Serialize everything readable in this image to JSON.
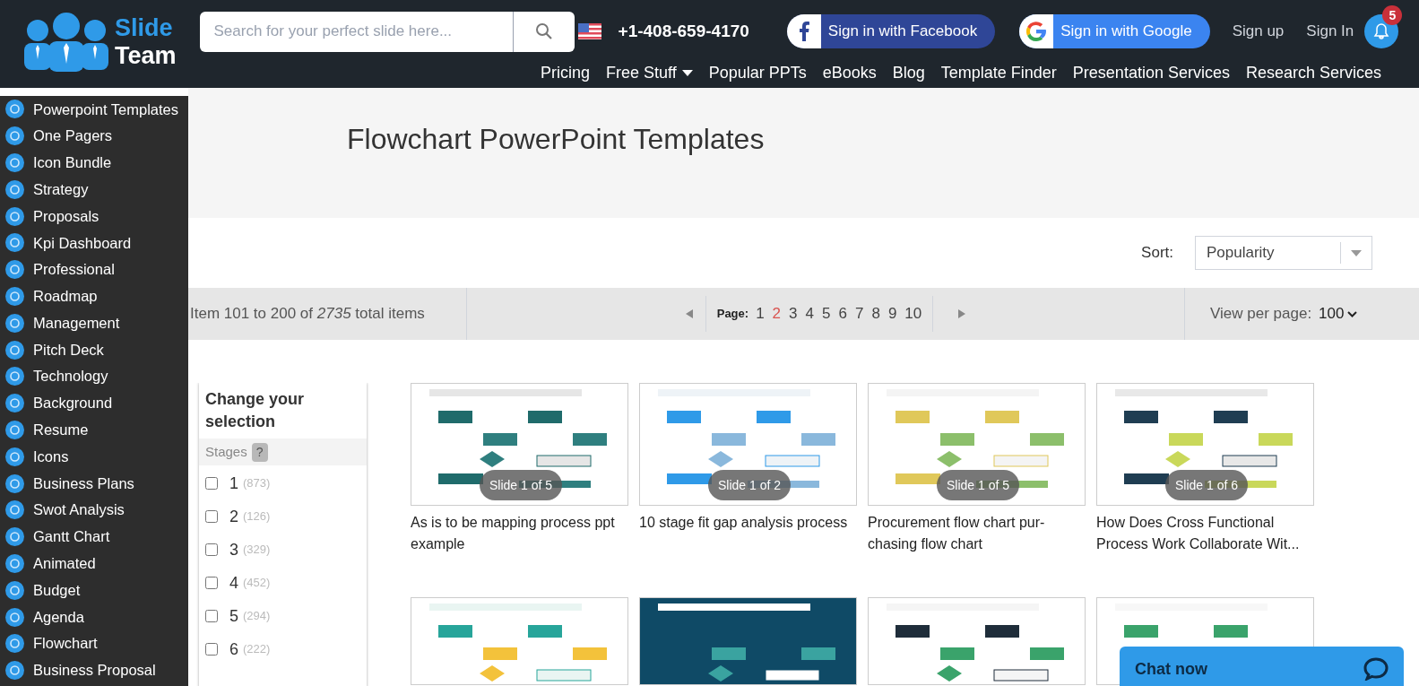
{
  "header": {
    "logo": {
      "line_1": "Slide",
      "line_2": "Team"
    },
    "search": {
      "placeholder": "Search for your perfect slide here..."
    },
    "phone": "+1-408-659-4170",
    "facebook_button": "Sign in with Facebook",
    "google_button": "Sign in with Google",
    "sign_up": "Sign up",
    "sign_in": "Sign In",
    "notification_count": "5",
    "nav": [
      {
        "label": "Pricing",
        "dropdown": false
      },
      {
        "label": "Free Stuff",
        "dropdown": true
      },
      {
        "label": "Popular PPTs",
        "dropdown": false
      },
      {
        "label": "eBooks",
        "dropdown": false
      },
      {
        "label": "Blog",
        "dropdown": false
      },
      {
        "label": "Template Finder",
        "dropdown": false
      },
      {
        "label": "Presentation Services",
        "dropdown": false
      },
      {
        "label": "Research Services",
        "dropdown": false
      }
    ]
  },
  "sidebar": {
    "items": [
      {
        "label": "Powerpoint Templates"
      },
      {
        "label": "One Pagers"
      },
      {
        "label": "Icon Bundle"
      },
      {
        "label": "Strategy"
      },
      {
        "label": "Proposals"
      },
      {
        "label": "Kpi Dashboard"
      },
      {
        "label": "Professional"
      },
      {
        "label": "Roadmap"
      },
      {
        "label": "Management"
      },
      {
        "label": "Pitch Deck"
      },
      {
        "label": "Technology"
      },
      {
        "label": "Background"
      },
      {
        "label": "Resume"
      },
      {
        "label": "Icons"
      },
      {
        "label": "Business Plans"
      },
      {
        "label": "Swot Analysis"
      },
      {
        "label": "Gantt Chart"
      },
      {
        "label": "Animated"
      },
      {
        "label": "Budget"
      },
      {
        "label": "Agenda"
      },
      {
        "label": "Flowchart"
      },
      {
        "label": "Business Proposal"
      }
    ]
  },
  "page_title": "Flowchart PowerPoint Templates",
  "sort": {
    "label": "Sort:",
    "value": "Popularity"
  },
  "toolbar": {
    "item_range": "Item 101 to 200 of *2735* total items",
    "page_label": "Page:",
    "pages": [
      {
        "label": "1",
        "selected": false
      },
      {
        "label": "2",
        "selected": true
      },
      {
        "label": "3",
        "selected": false
      },
      {
        "label": "4",
        "selected": false
      },
      {
        "label": "5",
        "selected": false
      },
      {
        "label": "6",
        "selected": false
      },
      {
        "label": "7",
        "selected": false
      },
      {
        "label": "8",
        "selected": false
      },
      {
        "label": "9",
        "selected": false
      },
      {
        "label": "10",
        "selected": false
      }
    ],
    "per_page_label": "View per page:",
    "per_page_value": "100"
  },
  "filter": {
    "title": "Change your selection",
    "group": "Stages",
    "help": "?",
    "options": [
      {
        "label": "1",
        "count": "(873)",
        "checked": false
      },
      {
        "label": "2",
        "count": "(126)",
        "checked": false
      },
      {
        "label": "3",
        "count": "(329)",
        "checked": false
      },
      {
        "label": "4",
        "count": "(452)",
        "checked": false
      },
      {
        "label": "5",
        "count": "(294)",
        "checked": false
      },
      {
        "label": "6",
        "count": "(222)",
        "checked": false
      }
    ]
  },
  "products": [
    {
      "kind": "picture",
      "slide_badge": "Slide 1 of 5",
      "title": "As is to be mapping process ppt example"
    },
    {
      "kind": "picture",
      "slide_badge": "Slide 1 of 2",
      "title": "10 stage fit gap analysis process"
    },
    {
      "kind": "picture",
      "slide_badge": "Slide 1 of 5",
      "title": "Procurement flow chart pur-chasing flow chart"
    },
    {
      "kind": "picture",
      "slide_badge": "Slide 1 of 6",
      "title": "How Does Cross Functional Process Work Collaborate Wit..."
    },
    {
      "kind": "picture"
    },
    {
      "kind": "picture"
    },
    {
      "kind": "picture"
    },
    {
      "kind": "picture"
    }
  ],
  "chat": {
    "label": "Chat now"
  }
}
